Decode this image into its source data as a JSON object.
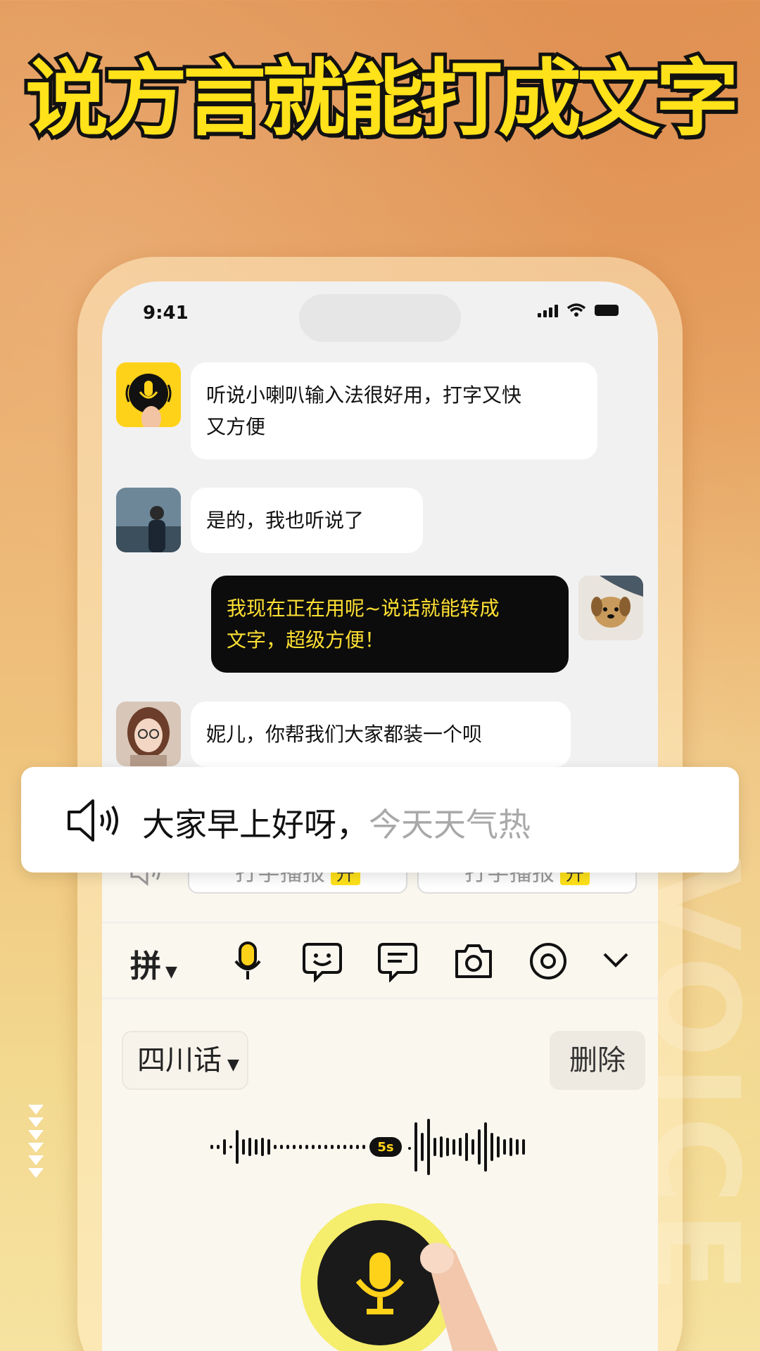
{
  "headline": "说方言就能打成文字",
  "status_bar": {
    "time": "9:41"
  },
  "messages": [
    {
      "side": "left",
      "avatar": "app-logo-icon",
      "text": "听说小喇叭输入法很好用，打字又快\n又方便"
    },
    {
      "side": "left",
      "avatar": "user-avatar-man",
      "text": "是的，我也听说了"
    },
    {
      "side": "right",
      "avatar": "user-avatar-dog",
      "text": "我现在正在用呢~说话就能转成\n文字，超级方便！"
    },
    {
      "side": "left",
      "avatar": "user-avatar-girl",
      "text": "妮儿，你帮我们大家都装一个呗"
    }
  ],
  "floating_card": {
    "icon": "speaker-icon",
    "text_main": "大家早上好呀，",
    "text_pending": "今天天气热"
  },
  "keyboard": {
    "chips": [
      {
        "label": "打字播报",
        "tag": "升"
      },
      {
        "label": "打字播报",
        "tag": "升"
      }
    ],
    "toolbar": {
      "input_mode": "拼",
      "icons": [
        "mic-icon",
        "emoji-icon",
        "phrase-icon",
        "camera-icon",
        "settings-icon",
        "collapse-icon"
      ]
    },
    "dialect": "四川话",
    "delete_label": "删除",
    "timer": "5s"
  },
  "colors": {
    "accent": "#ffe21a",
    "dark": "#0c0c0c"
  }
}
